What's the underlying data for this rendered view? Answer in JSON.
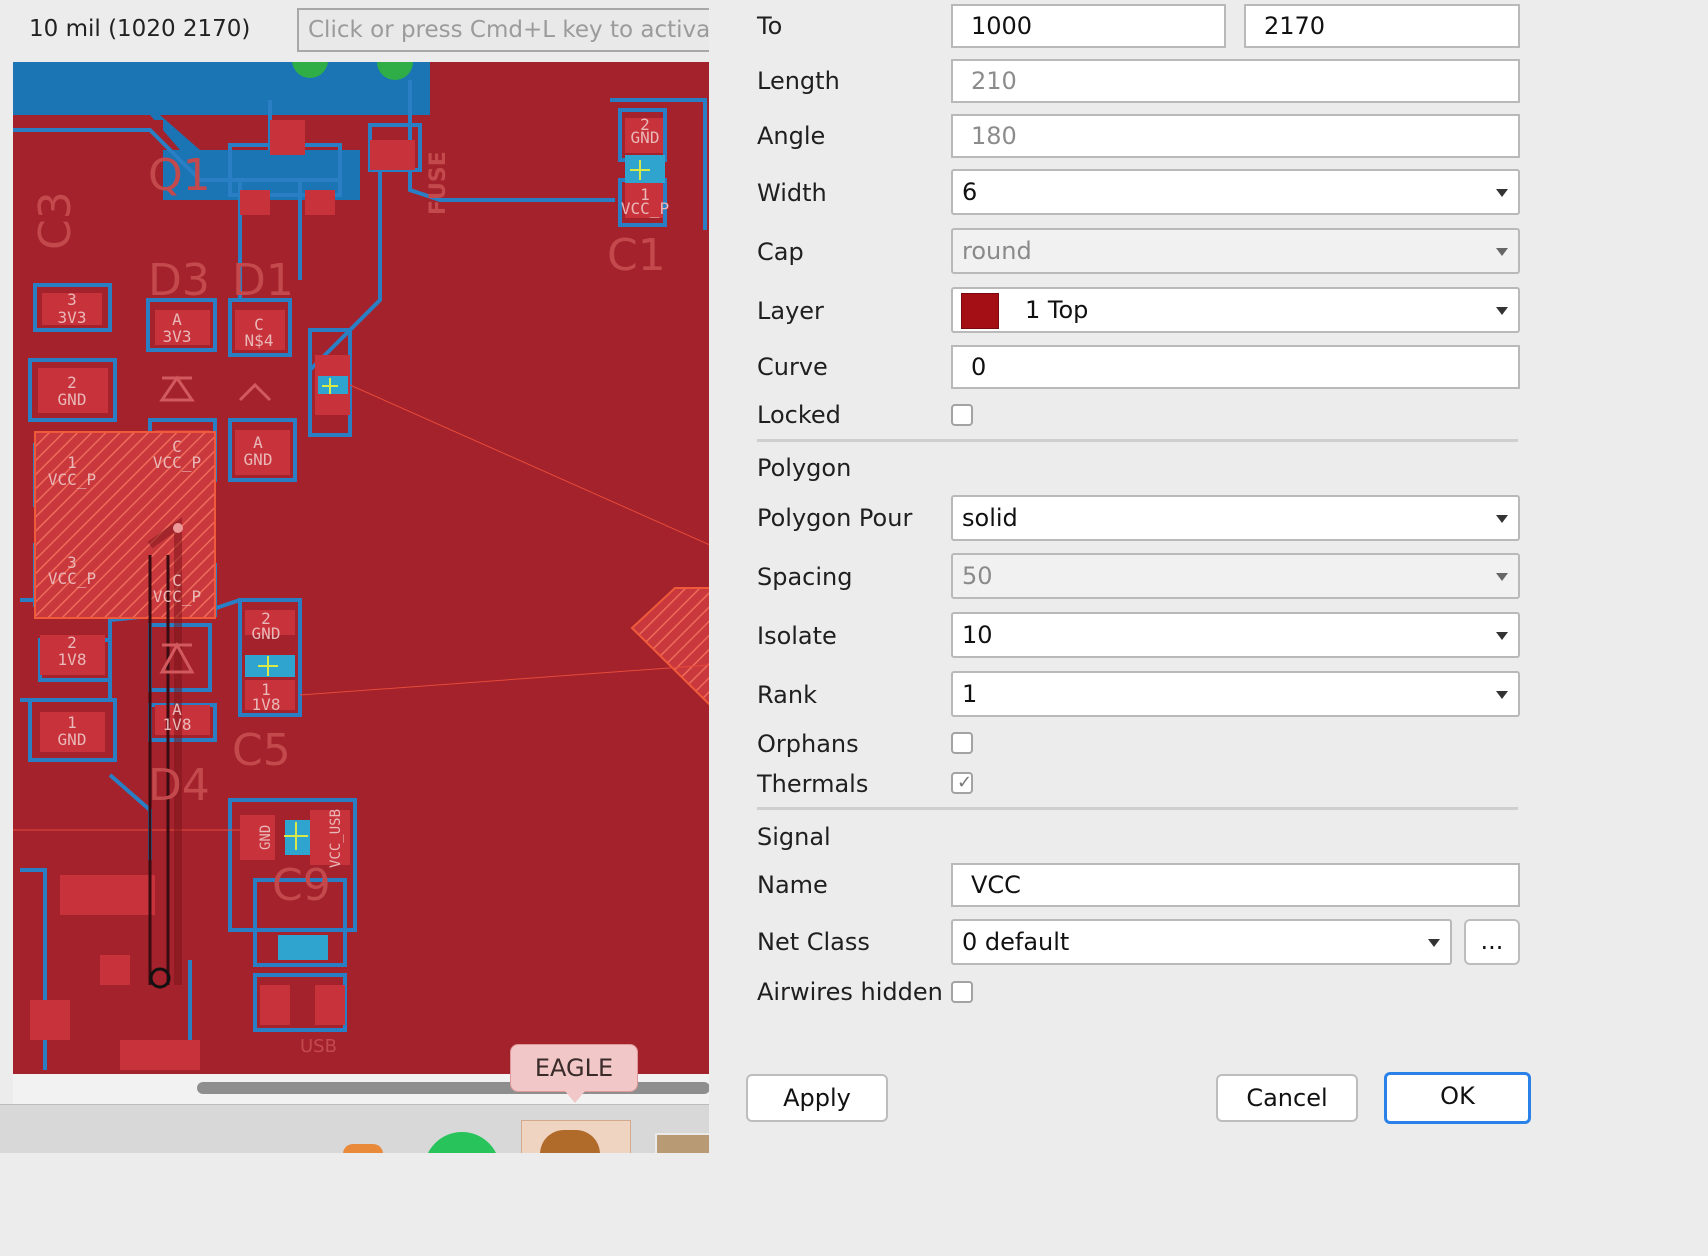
{
  "editor": {
    "coord_display": "10 mil (1020 2170)",
    "command_placeholder": "Click or press Cmd+L key to activa",
    "canvas_labels": {
      "q1": "Q1",
      "c3": "C3",
      "d3": "D3",
      "d1": "D1",
      "c1": "C1",
      "c5": "C5",
      "d4": "D4",
      "c9": "C9",
      "fuse": "FUSE",
      "usb": "USB",
      "pad_3v3_a": "3V3",
      "pad_3v3_b": "3V3",
      "pad_n14": "N$4",
      "pad_gnd_a": "GND",
      "pad_gnd_b": "GND",
      "pad_vccp_a": "VCC_P",
      "pad_vccp_b": "VCC_P",
      "pad_vccp_c": "VCC_P",
      "pad_vccp_d": "VCC_P",
      "pad_vccp_e": "VCC_P",
      "pad_1v8_a": "1V8",
      "pad_1v8_b": "1V8",
      "pad_1v8_c": "1V8",
      "pad_gnd_c": "GND",
      "pad_gnd_d": "GND",
      "pad_gnd_e": "GND",
      "pad_gnd_f": "GND",
      "pad_vccusb": "VCC_USB",
      "n3": "3",
      "nA1": "A",
      "nC1": "C",
      "n2a": "2",
      "nA2": "A",
      "n1a": "1",
      "nC2": "C",
      "n3b": "3",
      "nC3": "C",
      "n2b": "2",
      "nA3": "A",
      "n1b": "1",
      "n2c": "2",
      "n1c": "1",
      "n2d": "2",
      "n1d": "1"
    },
    "tooltip": "EAGLE"
  },
  "dialog": {
    "to_label": "To",
    "to_x": "1000",
    "to_y": "2170",
    "length_label": "Length",
    "length_value": "210",
    "angle_label": "Angle",
    "angle_value": "180",
    "width_label": "Width",
    "width_value": "6",
    "cap_label": "Cap",
    "cap_value": "round",
    "layer_label": "Layer",
    "layer_value": "1 Top",
    "layer_color": "#a40f16",
    "curve_label": "Curve",
    "curve_value": "0",
    "locked_label": "Locked",
    "locked_checked": false,
    "polygon_section": "Polygon",
    "pour_label": "Polygon Pour",
    "pour_value": "solid",
    "spacing_label": "Spacing",
    "spacing_value": "50",
    "isolate_label": "Isolate",
    "isolate_value": "10",
    "rank_label": "Rank",
    "rank_value": "1",
    "orphans_label": "Orphans",
    "orphans_checked": false,
    "thermals_label": "Thermals",
    "thermals_checked": true,
    "signal_section": "Signal",
    "name_label": "Name",
    "name_value": "VCC",
    "netclass_label": "Net Class",
    "netclass_value": "0 default",
    "netclass_more": "...",
    "airwires_label": "Airwires hidden",
    "airwires_checked": false,
    "apply_label": "Apply",
    "cancel_label": "Cancel",
    "ok_label": "OK"
  },
  "colors": {
    "board_copper": "#a3222c",
    "pad_red": "#c8323b",
    "outline_blue": "#2a7fc4",
    "accent_blue": "#2a82e8"
  }
}
